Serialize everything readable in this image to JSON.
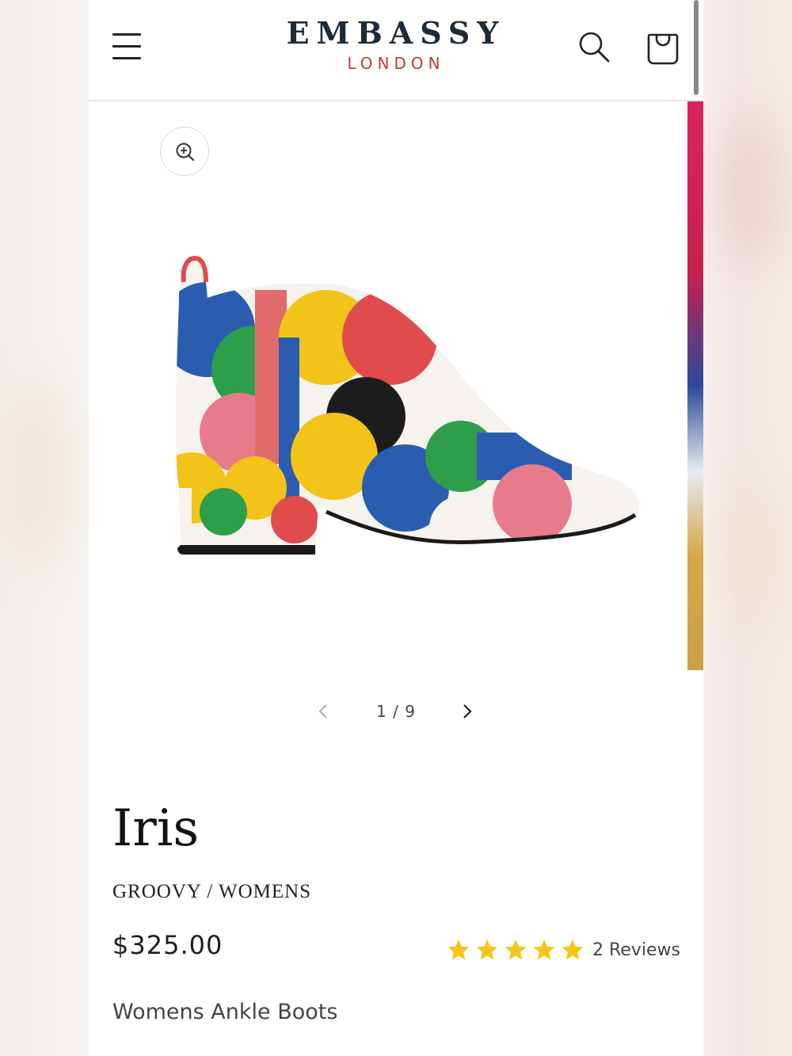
{
  "brand": {
    "name": "EMBASSY",
    "subtitle": "LONDON"
  },
  "header": {
    "menu_icon": "hamburger-menu-icon",
    "search_icon": "search-icon",
    "cart_icon": "cart-bag-icon"
  },
  "gallery": {
    "zoom_icon": "zoom-in-icon",
    "current": 1,
    "total": 9,
    "counter_text": "1 / 9",
    "prev_icon": "chevron-left-icon",
    "next_icon": "chevron-right-icon"
  },
  "product": {
    "title": "Iris",
    "breadcrumb": "GROOVY / WOMENS",
    "price": "$325.00",
    "rating": {
      "stars": 5,
      "max": 5,
      "reviews_text": "2 Reviews"
    },
    "description": "Womens Ankle Boots"
  },
  "colors": {
    "brand_navy": "#1d2a3a",
    "brand_red": "#c13b34",
    "star_yellow": "#f5c518"
  }
}
